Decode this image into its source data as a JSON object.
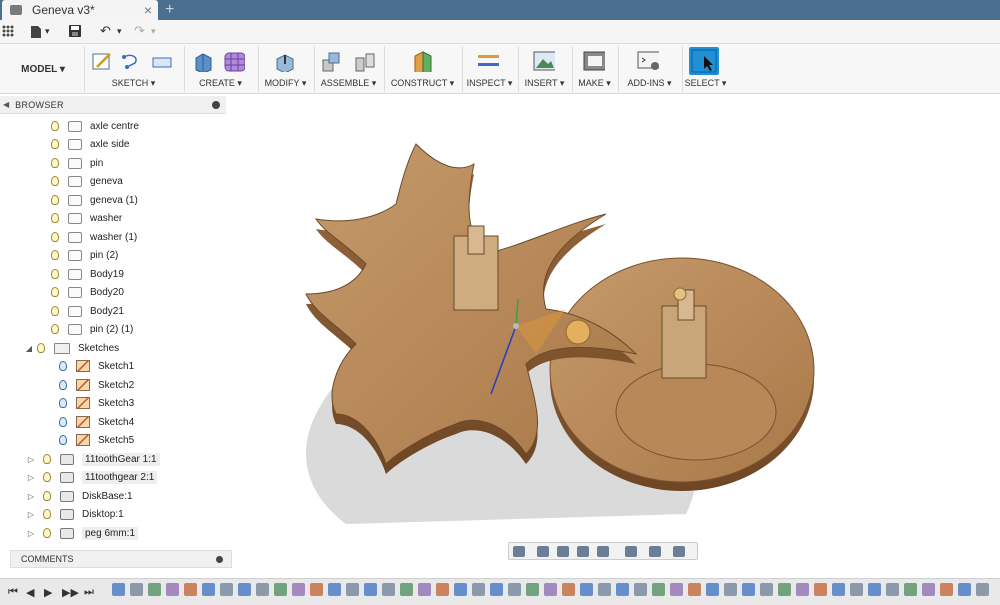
{
  "app": {
    "tab_title": "Geneva v3*",
    "tab_close": "×",
    "new_tab": "+"
  },
  "quickbar": {
    "file_caret": "▾",
    "undo": "↶",
    "undo_caret": "▾",
    "redo": "↷",
    "redo_caret": "▾"
  },
  "ribbon": {
    "workspace": "MODEL ▾",
    "groups": [
      {
        "label": "SKETCH ▾"
      },
      {
        "label": "CREATE ▾"
      },
      {
        "label": "MODIFY ▾"
      },
      {
        "label": "ASSEMBLE ▾"
      },
      {
        "label": "CONSTRUCT ▾"
      },
      {
        "label": "INSPECT ▾"
      },
      {
        "label": "INSERT ▾"
      },
      {
        "label": "MAKE ▾"
      },
      {
        "label": "ADD-INS ▾"
      },
      {
        "label": "SELECT ▾"
      }
    ],
    "colors": {
      "accent": "#1f8fd6",
      "tabbar": "#4a6f8f"
    }
  },
  "browser": {
    "title": "BROWSER",
    "bodies": [
      "axle centre",
      "axle side",
      "pin",
      "geneva",
      "geneva (1)",
      "washer",
      "washer (1)",
      "pin (2)",
      "Body19",
      "Body20",
      "Body21",
      "pin (2) (1)"
    ],
    "sketches_folder": "Sketches",
    "sketches": [
      "Sketch1",
      "Sketch2",
      "Sketch3",
      "Sketch4",
      "Sketch5"
    ],
    "components": [
      "11toothGear 1:1",
      "11toothgear 2:1",
      "DiskBase:1",
      "Disktop:1",
      "peg 6mm:1"
    ]
  },
  "comments": {
    "title": "COMMENTS"
  },
  "timeline": {
    "buttons": [
      "⏮",
      "◀",
      "▶",
      "▶▶",
      "⏭"
    ]
  }
}
